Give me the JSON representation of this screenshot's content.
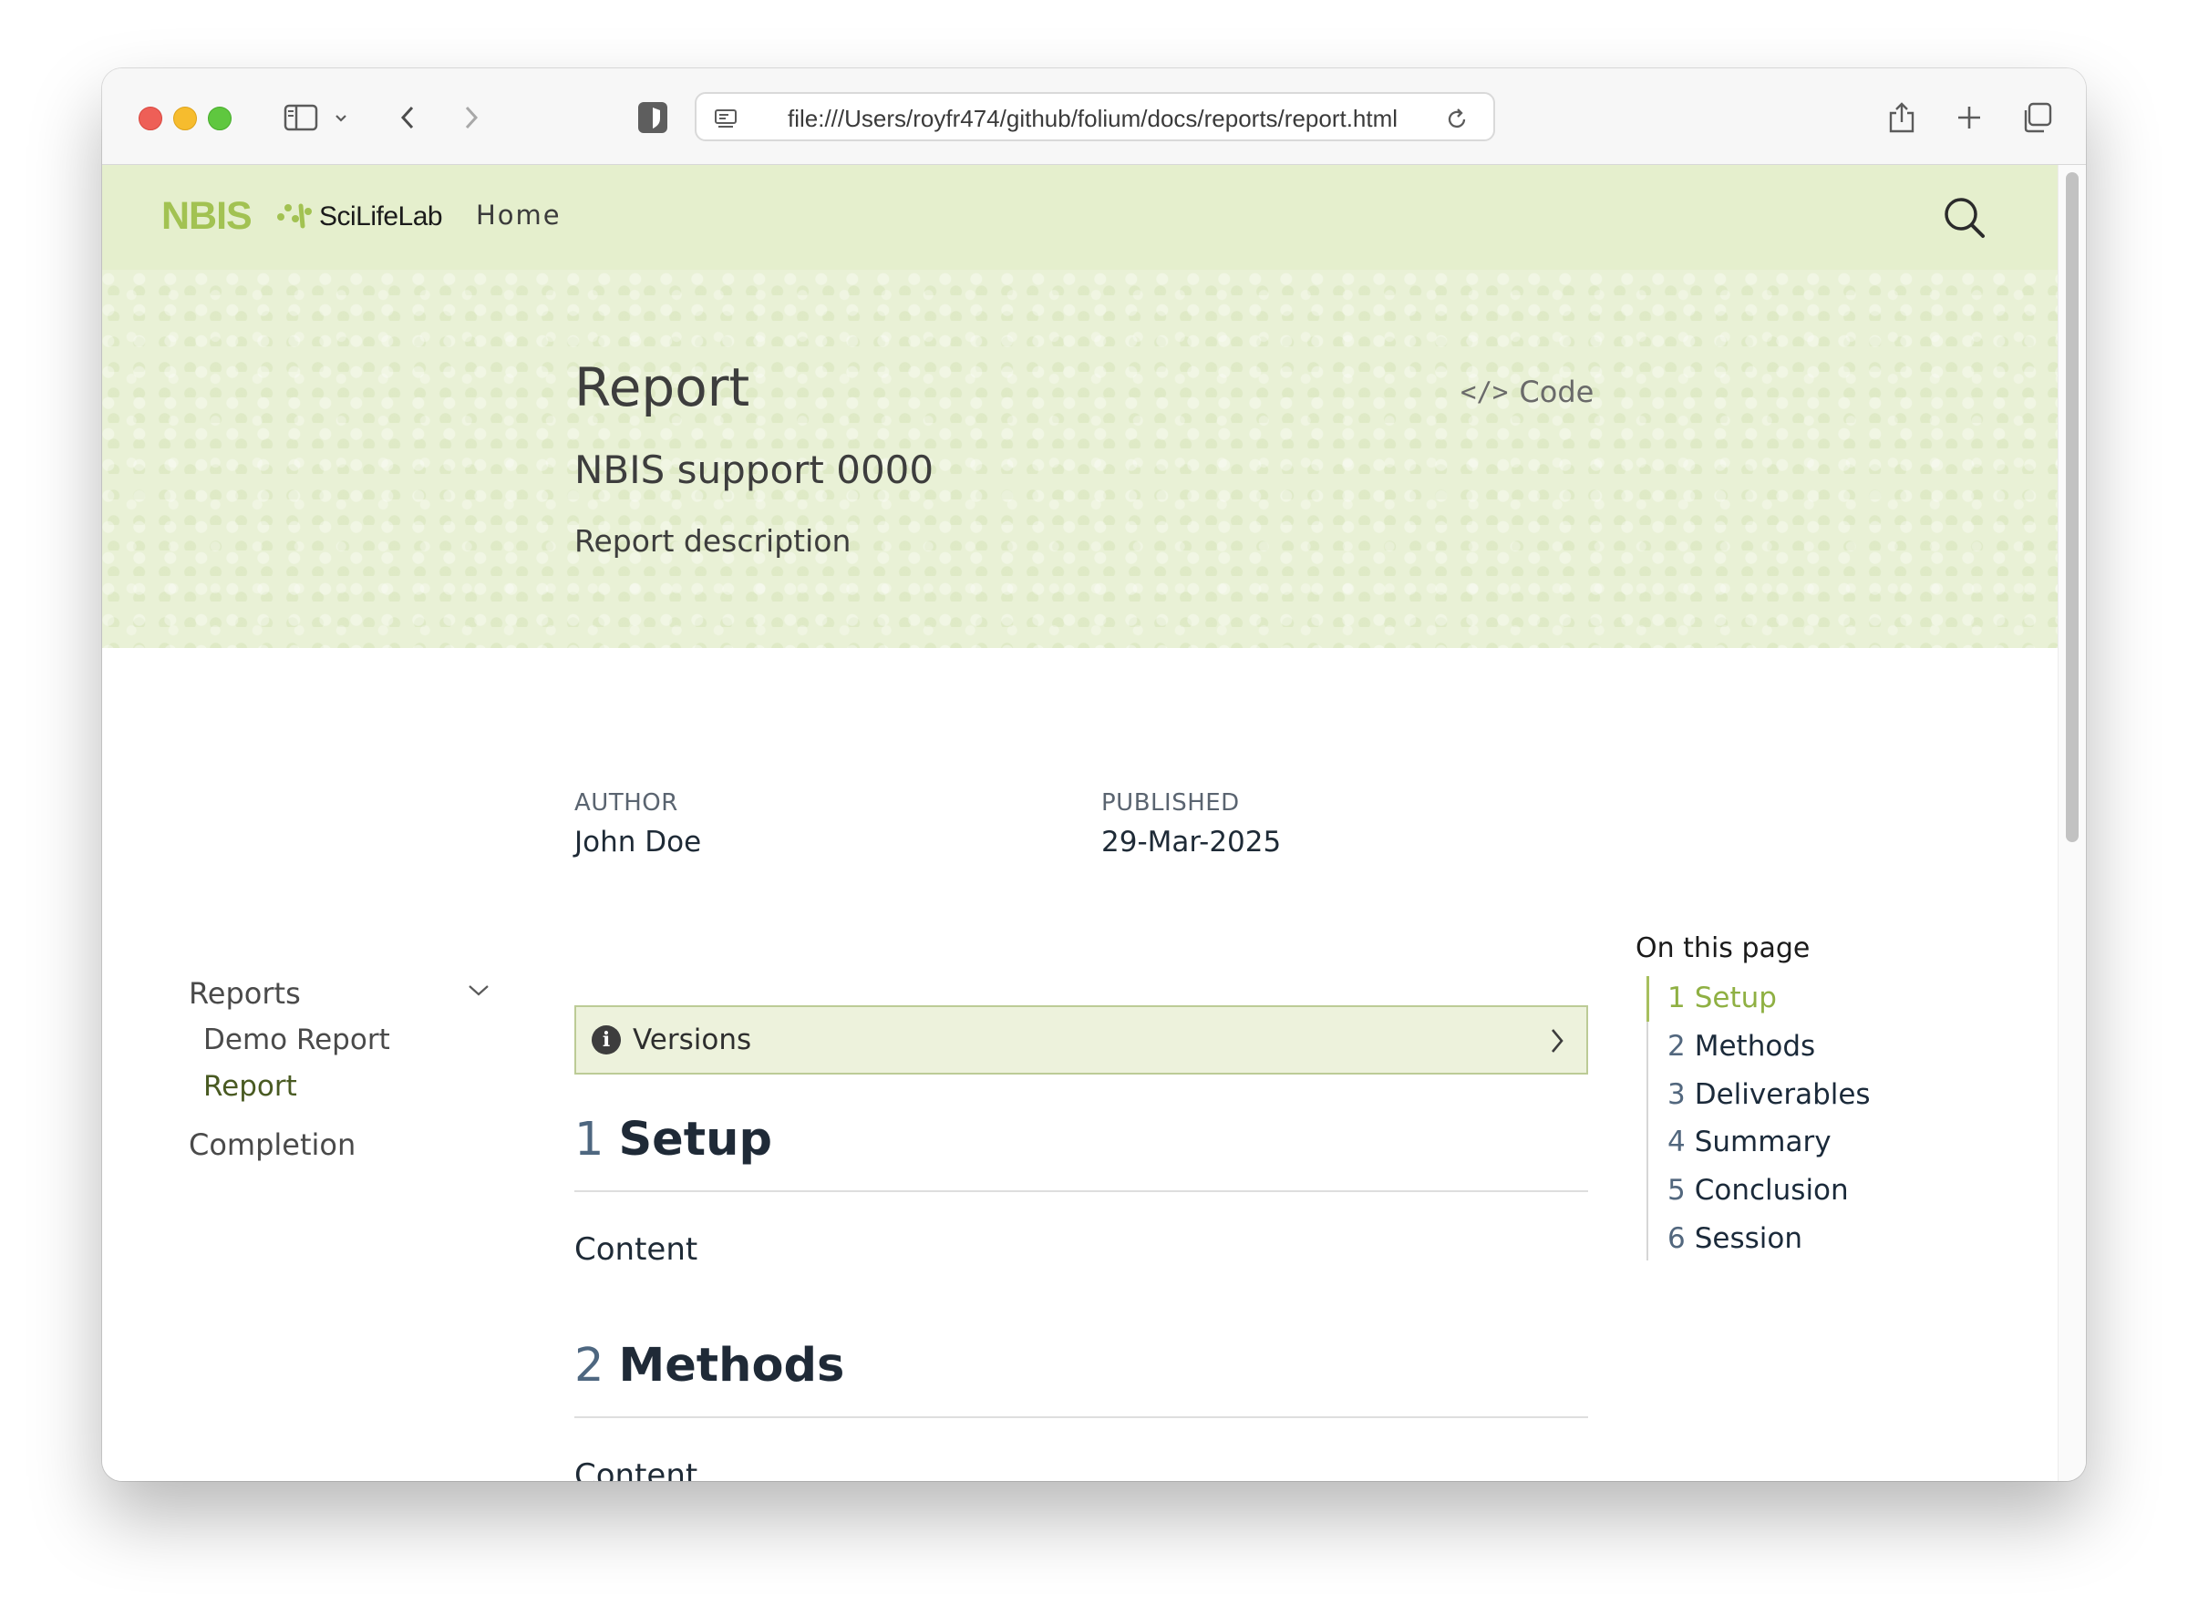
{
  "browser": {
    "url": "file:///Users/royfr474/github/folium/docs/reports/report.html"
  },
  "navbar": {
    "logo_nbis": "NBIS",
    "logo_scilifelab": "SciLifeLab",
    "home": "Home"
  },
  "hero": {
    "title": "Report",
    "subtitle": "NBIS support 0000",
    "description": "Report description",
    "code_label": "Code"
  },
  "meta": {
    "author_label": "AUTHOR",
    "author": "John Doe",
    "published_label": "PUBLISHED",
    "published": "29-Mar-2025"
  },
  "sidebar": {
    "items": [
      {
        "label": "Reports"
      },
      {
        "label": "Demo Report"
      },
      {
        "label": "Report",
        "active": true
      },
      {
        "label": "Completion"
      }
    ]
  },
  "callout": {
    "title": "Versions"
  },
  "sections": [
    {
      "number": "1",
      "title": "Setup",
      "content": "Content"
    },
    {
      "number": "2",
      "title": "Methods",
      "content": "Content"
    }
  ],
  "toc": {
    "title": "On this page",
    "items": [
      {
        "number": "1",
        "label": "Setup"
      },
      {
        "number": "2",
        "label": "Methods"
      },
      {
        "number": "3",
        "label": "Deliverables"
      },
      {
        "number": "4",
        "label": "Summary"
      },
      {
        "number": "5",
        "label": "Conclusion"
      },
      {
        "number": "6",
        "label": "Session"
      }
    ]
  },
  "colors": {
    "brand_green": "#a2c252",
    "navbar_bg": "#e5efcd",
    "hero_bg": "#e9f1d6",
    "active_link": "#8fb043"
  }
}
